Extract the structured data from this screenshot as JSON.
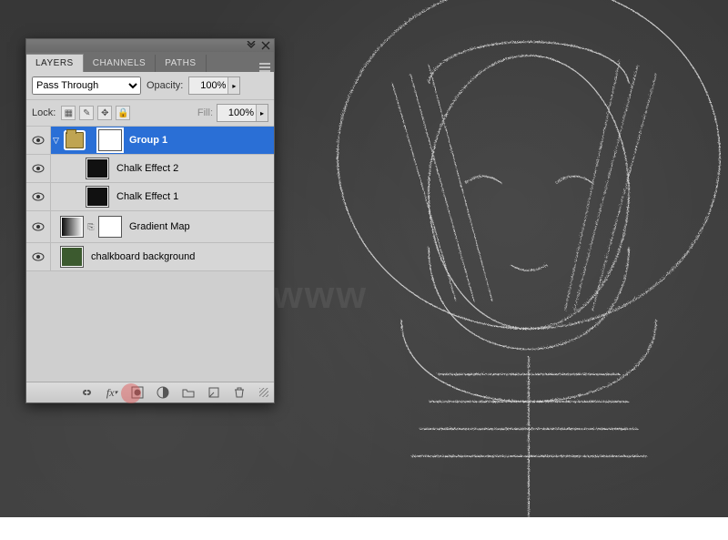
{
  "watermark": "www",
  "panel": {
    "tabs": [
      {
        "label": "LAYERS",
        "active": true
      },
      {
        "label": "CHANNELS",
        "active": false
      },
      {
        "label": "PATHS",
        "active": false
      }
    ],
    "blend_mode": "Pass Through",
    "opacity_label": "Opacity:",
    "opacity_value": "100%",
    "lock_label": "Lock:",
    "fill_label": "Fill:",
    "fill_value": "100%",
    "layers": [
      {
        "name": "Group 1",
        "visible": true,
        "selected": true,
        "indent": 0,
        "kind": "group",
        "thumbs": [
          "group",
          "mask"
        ]
      },
      {
        "name": "Chalk Effect 2",
        "visible": true,
        "selected": false,
        "indent": 1,
        "kind": "layer",
        "thumbs": [
          "dark"
        ]
      },
      {
        "name": "Chalk Effect 1",
        "visible": true,
        "selected": false,
        "indent": 1,
        "kind": "layer",
        "thumbs": [
          "dark"
        ]
      },
      {
        "name": "Gradient Map",
        "visible": true,
        "selected": false,
        "indent": 0,
        "kind": "adjustment",
        "thumbs": [
          "grad",
          "mask"
        ]
      },
      {
        "name": "chalkboard background",
        "visible": true,
        "selected": false,
        "indent": 0,
        "kind": "layer",
        "thumbs": [
          "green"
        ]
      }
    ],
    "footer_icons": [
      "link-icon",
      "fx-icon",
      "mask-icon",
      "adjustment-icon",
      "group-icon",
      "new-layer-icon",
      "trash-icon"
    ],
    "highlighted_footer_icon": "mask-icon"
  },
  "colors": {
    "selection": "#2a6fd6",
    "panel_bg": "#d5d5d5",
    "chalkboard": "#3c3c3c"
  }
}
